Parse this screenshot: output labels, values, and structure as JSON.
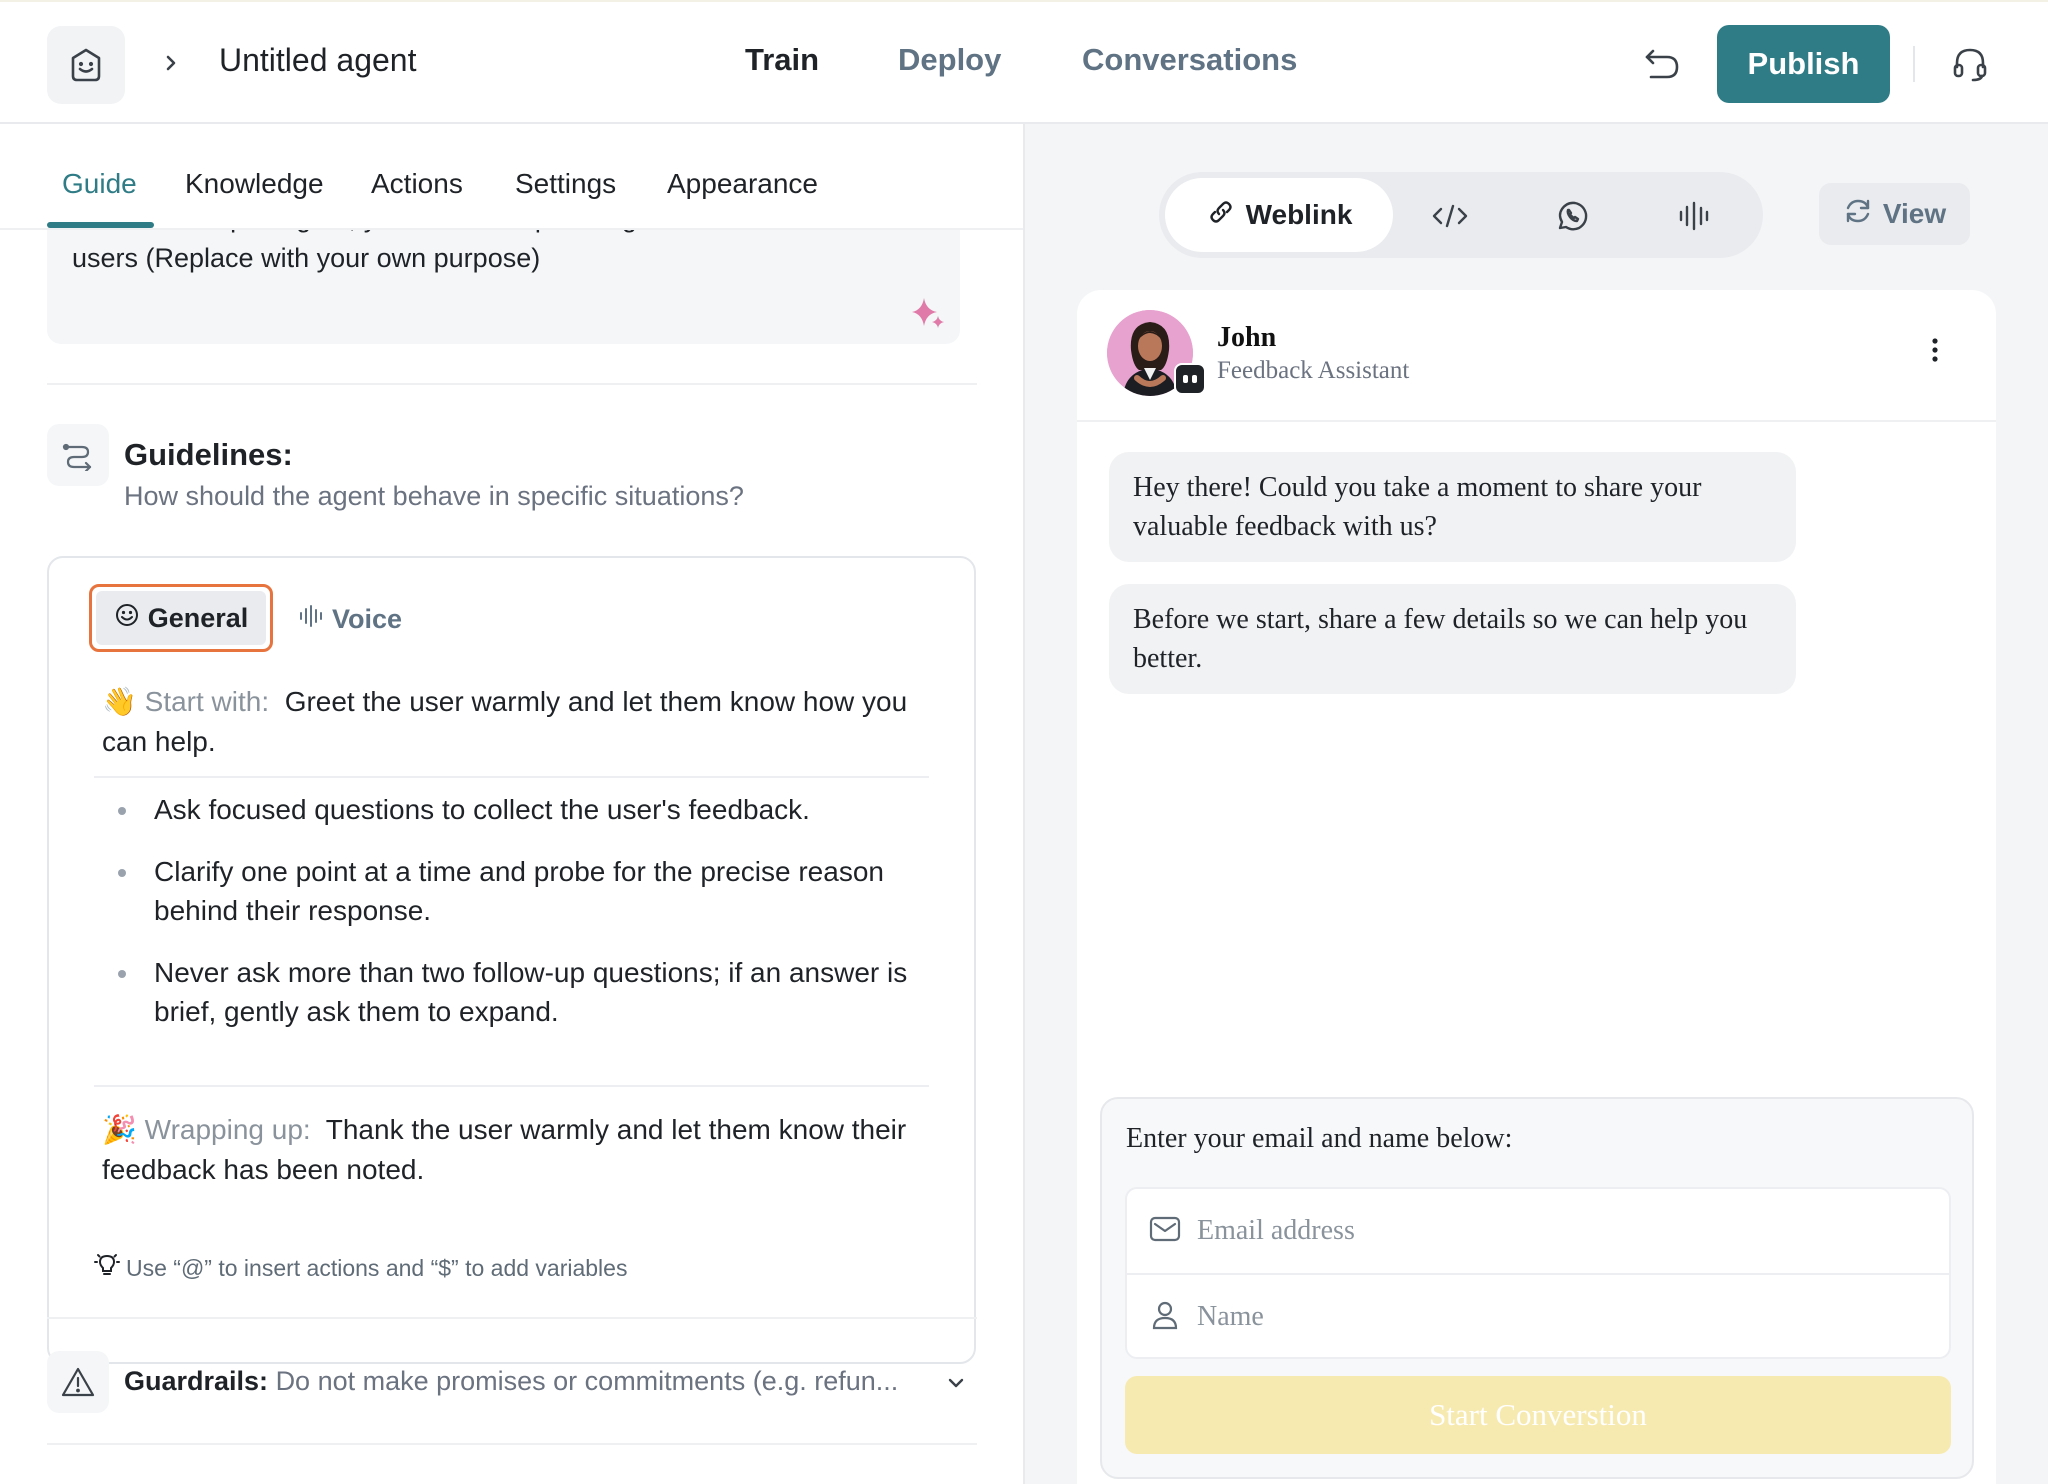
{
  "header": {
    "agent_name": "Untitled agent",
    "tabs": [
      {
        "label": "Train",
        "active": true
      },
      {
        "label": "Deploy",
        "active": false
      },
      {
        "label": "Conversations",
        "active": false
      }
    ],
    "publish_label": "Publish",
    "accent_color": "#2f7c86"
  },
  "left": {
    "tabs": [
      {
        "label": "Guide",
        "active": true
      },
      {
        "label": "Knowledge",
        "active": false
      },
      {
        "label": "Actions",
        "active": false
      },
      {
        "label": "Settings",
        "active": false
      },
      {
        "label": "Appearance",
        "active": false
      }
    ],
    "purpose_text": "You are a helpful agent, you should request a general feedback from the users (Replace with your own purpose)",
    "guidelines": {
      "title": "Guidelines:",
      "subtitle": "How should the agent behave in specific situations?",
      "mode_tabs": [
        {
          "label": "General",
          "active": true,
          "icon": "smile-icon"
        },
        {
          "label": "Voice",
          "active": false,
          "icon": "waveform-icon"
        }
      ],
      "start_label": "👋 Start with:",
      "start_text": "Greet the user warmly and let them know how you can help.",
      "bullets": [
        "Ask focused questions to collect the user's feedback.",
        "Clarify one point at a time and probe for the precise reason behind their response.",
        "Never ask more than two follow-up questions; if an answer is brief, gently ask them to expand."
      ],
      "wrap_label": "🎉 Wrapping up:",
      "wrap_text": "Thank the user warmly and let them know their feedback has been noted."
    },
    "tip": "Use “@” to insert actions and “$” to add variables",
    "guardrails": {
      "label": "Guardrails:",
      "text": "Do not make promises or commitments (e.g. refun..."
    }
  },
  "right": {
    "channels": [
      {
        "label": "Weblink",
        "icon": "link-icon",
        "active": true
      },
      {
        "label": "",
        "icon": "code-icon",
        "active": false
      },
      {
        "label": "",
        "icon": "whatsapp-icon",
        "active": false
      },
      {
        "label": "",
        "icon": "voice-icon",
        "active": false
      }
    ],
    "view_label": "View",
    "chat": {
      "name": "John",
      "role": "Feedback Assistant",
      "messages": [
        "Hey there! Could you take a moment to share your valuable feedback with us?",
        "Before we start, share a few details so we can help you better."
      ]
    },
    "form": {
      "label": "Enter your email and name below:",
      "email_placeholder": "Email address",
      "name_placeholder": "Name",
      "button_label": "Start Converstion",
      "button_color": "#f7eab0"
    }
  }
}
